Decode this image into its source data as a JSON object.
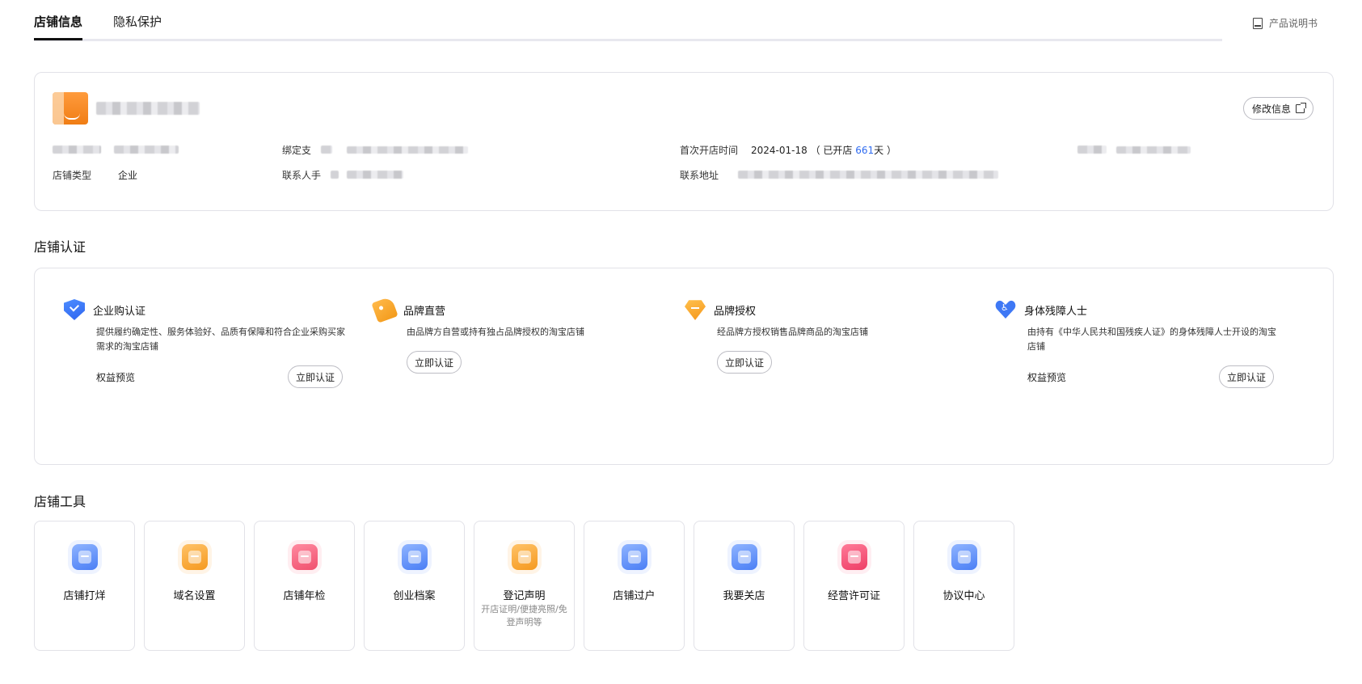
{
  "tabs": {
    "items": [
      {
        "label": "店铺信息",
        "active": true
      },
      {
        "label": "隐私保护",
        "active": false
      }
    ],
    "manual_link": "产品说明书"
  },
  "shop": {
    "edit_label": "修改信息",
    "fields": {
      "binding_label": "绑定支",
      "contact_phone_label": "联系人手",
      "first_open_label": "首次开店时间",
      "first_open_date": "2024-01-18",
      "opened_prefix": "（ 已开店 ",
      "opened_days": "661",
      "opened_suffix": "天 ）",
      "address_label": "联系地址",
      "type_label": "店铺类型",
      "type_value": "企业"
    }
  },
  "certification": {
    "title": "店铺认证",
    "items": [
      {
        "icon": "shield-check-icon",
        "name": "企业购认证",
        "desc": "提供履约确定性、服务体验好、品质有保障和符合企业采购买家需求的淘宝店铺",
        "link": "权益预览",
        "button": "立即认证"
      },
      {
        "icon": "price-tag-icon",
        "name": "品牌直营",
        "desc": "由品牌方自营或持有独占品牌授权的淘宝店铺",
        "button": "立即认证"
      },
      {
        "icon": "diamond-icon",
        "name": "品牌授权",
        "desc": "经品牌方授权销售品牌商品的淘宝店铺",
        "button": "立即认证"
      },
      {
        "icon": "heart-accessibility-icon",
        "name": "身体残障人士",
        "desc": "由持有《中华人民共和国残疾人证》的身体残障人士开设的淘宝店铺",
        "link": "权益预览",
        "button": "立即认证"
      }
    ]
  },
  "tools": {
    "title": "店铺工具",
    "items": [
      {
        "name": "店铺打烊",
        "icon": "shop-close-icon"
      },
      {
        "name": "域名设置",
        "icon": "domain-icon"
      },
      {
        "name": "店铺年检",
        "icon": "annual-check-icon"
      },
      {
        "name": "创业档案",
        "icon": "archive-icon"
      },
      {
        "name": "登记声明",
        "sub": "开店证明/便捷亮照/免登声明等",
        "icon": "declaration-icon"
      },
      {
        "name": "店铺过户",
        "icon": "transfer-icon"
      },
      {
        "name": "我要关店",
        "icon": "close-shop-icon"
      },
      {
        "name": "经营许可证",
        "icon": "license-icon"
      },
      {
        "name": "协议中心",
        "icon": "agreement-icon"
      }
    ]
  },
  "colors": {
    "accent_blue": "#2f6bf0",
    "border": "#e2e2e8",
    "text": "#111111"
  }
}
